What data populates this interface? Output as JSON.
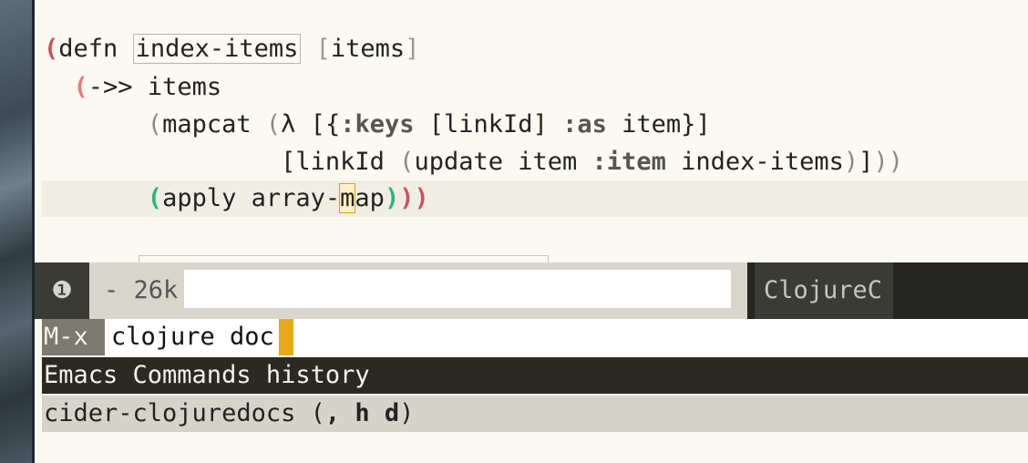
{
  "editor": {
    "line1": {
      "open": "(",
      "defn": "defn",
      "name": "index-items",
      "args_open": "[",
      "args": "items",
      "args_close": "]"
    },
    "line2": {
      "open": "(",
      "macro": "->>",
      "arg": "items"
    },
    "line3": {
      "open": "(",
      "fn": "mapcat",
      "lambda_open": "(",
      "lambda": "λ",
      "vec_open": "[",
      "map_open": "{",
      "keys_kw": ":keys",
      "inner_open": "[",
      "key_name": "linkId",
      "inner_close": "]",
      "as_kw": ":as",
      "as_name": "item",
      "map_close": "}",
      "vec_close": "]"
    },
    "line4": {
      "vec_open": "[",
      "key_name": "linkId",
      "upd_open": "(",
      "fn": "update",
      "target": "item",
      "item_kw": ":item",
      "func": "index-items",
      "upd_close": ")",
      "vec_close": "]",
      "tail": "))"
    },
    "line5": {
      "open": "(",
      "fn": "apply",
      "arg_pre": "array-",
      "arg_cursor": "m",
      "arg_post": "ap",
      "close_inner": ")",
      "close_mid": ")",
      "close_outer": ")"
    }
  },
  "modeline": {
    "badge": "❶",
    "size": "- 26k",
    "mode": "ClojureC"
  },
  "minibuffer": {
    "prompt": "M-x",
    "input": "clojure doc",
    "header": "Emacs Commands history",
    "candidate_name": "cider-clojuredocs",
    "candidate_open": " (",
    "candidate_keys": ", h d",
    "candidate_close": ")"
  },
  "colors": {
    "paren_red": "#c9535d",
    "paren_green": "#2fb37a",
    "cursor": "#e8a817",
    "header_bg": "#2a2a22"
  }
}
